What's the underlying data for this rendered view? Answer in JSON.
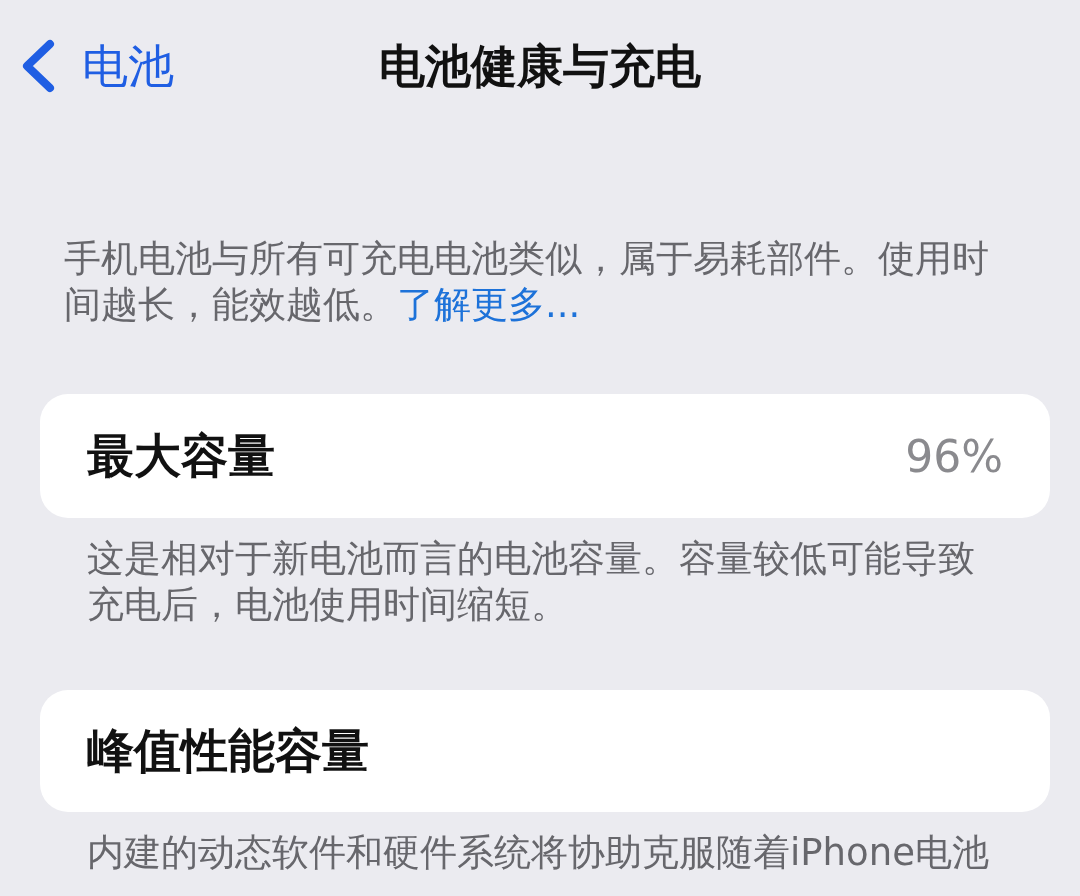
{
  "nav_bar": {
    "back_label": "电池",
    "title": "电池健康与充电"
  },
  "intro": {
    "text": "手机电池与所有可充电电池类似，属于易耗部件。使用时间越长，能效越低。",
    "link": "了解更多..."
  },
  "sections": [
    {
      "label": "最大容量",
      "value": "96%",
      "footer": "这是相对于新电池而言的电池容量。容量较低可能导致充电后，电池使用时间缩短。"
    },
    {
      "label": "峰值性能容量",
      "footer": "内建的动态软件和硬件系统将协助克服随着iPhone电池"
    }
  ]
}
